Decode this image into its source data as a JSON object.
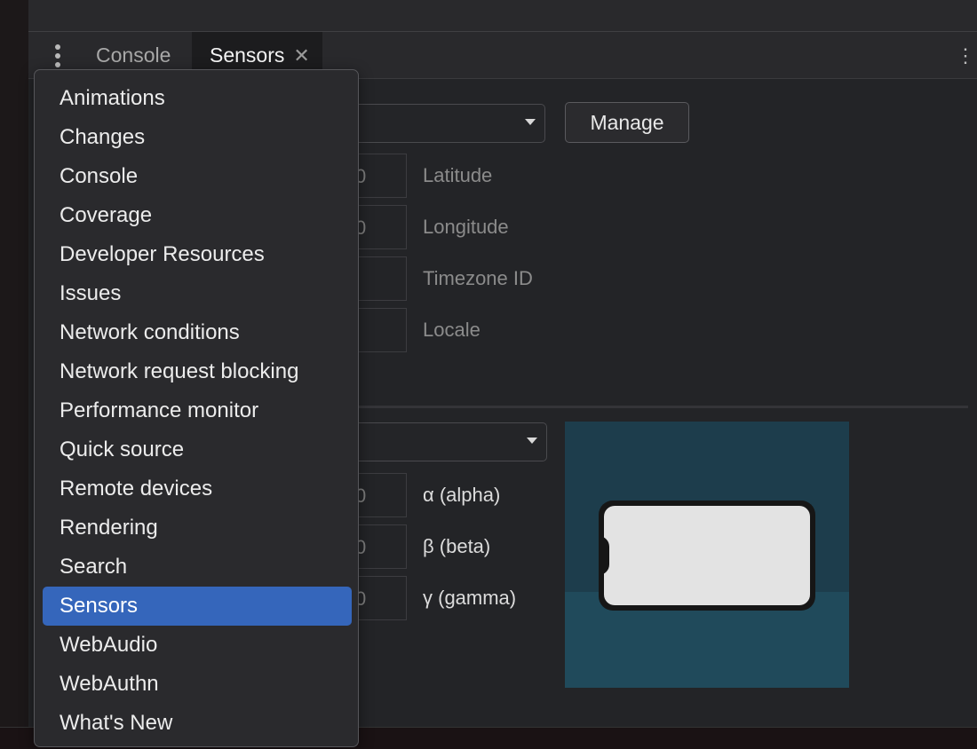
{
  "tabs": {
    "console": "Console",
    "sensors": "Sensors",
    "close_glyph": "✕"
  },
  "location": {
    "manage_label": "Manage",
    "fields": [
      {
        "value": "0",
        "label": "Latitude"
      },
      {
        "value": "0",
        "label": "Longitude"
      },
      {
        "value": "",
        "label": "Timezone ID"
      },
      {
        "value": "",
        "label": "Locale"
      }
    ]
  },
  "orientation": {
    "fields": [
      {
        "value": "0",
        "label": "α (alpha)"
      },
      {
        "value": "0",
        "label": "β (beta)"
      },
      {
        "value": "0",
        "label": "γ (gamma)"
      }
    ]
  },
  "menu": {
    "items": [
      "Animations",
      "Changes",
      "Console",
      "Coverage",
      "Developer Resources",
      "Issues",
      "Network conditions",
      "Network request blocking",
      "Performance monitor",
      "Quick source",
      "Remote devices",
      "Rendering",
      "Search",
      "Sensors",
      "WebAudio",
      "WebAuthn",
      "What's New"
    ],
    "selected": "Sensors"
  },
  "colors": {
    "accent": "#3566bb",
    "background": "#232427",
    "device_bg": "#1d3d4c"
  },
  "icons": {
    "kebab": "vertical-dots-icon",
    "close": "close-icon",
    "caret": "caret-down-icon"
  }
}
